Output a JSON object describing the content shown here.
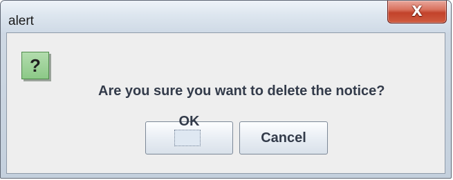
{
  "window": {
    "title": "alert",
    "close_glyph": "X"
  },
  "dialog": {
    "icon": "question-icon",
    "icon_glyph": "?",
    "message": "Are you sure you want to delete the notice?"
  },
  "buttons": {
    "ok_label": "OK",
    "cancel_label": "Cancel"
  },
  "colors": {
    "icon_background": "#9ed29a",
    "close_button": "#c94a33",
    "message_text": "#333b4a"
  }
}
